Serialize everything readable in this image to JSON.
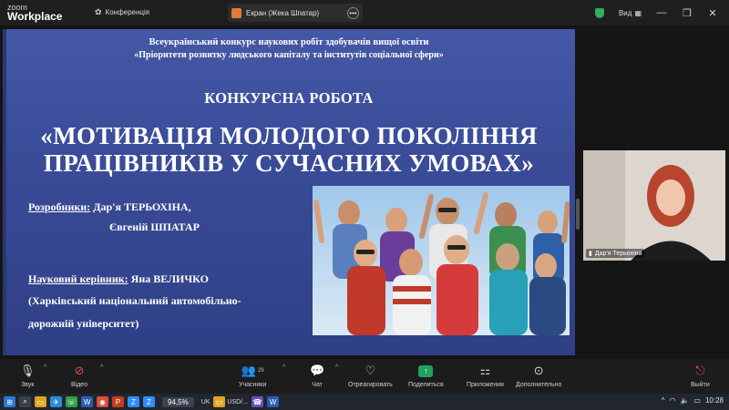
{
  "app": {
    "logo_line1": "zoom",
    "logo_line2": "Workplace",
    "conference_label": "Конференція",
    "screen_share_label": "Екран (Жека Шпатар)",
    "view_label": "Вид"
  },
  "slide": {
    "header_line1": "Всеукраїнський конкурс наукових робіт здобувачів вищої освіти",
    "header_line2": "«Пріоритети розвитку людського капіталу та інститутів соціальної сфери»",
    "section_title": "КОНКУРСНА РОБОТА",
    "work_title_line1": "«МОТИВАЦІЯ МОЛОДОГО ПОКОЛІННЯ",
    "work_title_line2": "ПРАЦІВНИКІВ У СУЧАСНИХ УМОВАХ»",
    "developers_label": "Розробники:",
    "developer1": "Дар'я ТЕРЬОХІНА,",
    "developer2": "Євгеній ШПАТАР",
    "supervisor_label": "Науковий керівник:",
    "supervisor_name": "Яна ВЕЛИЧКО",
    "university_line1": "(Харківський національний автомобільно-",
    "university_line2": "дорожній університет)"
  },
  "self_view": {
    "name": "Дар'я Терьохіна"
  },
  "toolbar": {
    "audio_label": "Звук",
    "video_label": "Відео",
    "participants_label": "Учасники",
    "participants_count": "29",
    "chat_label": "Чат",
    "react_label": "Отреагировать",
    "share_label": "Поделиться",
    "apps_label": "Приложения",
    "more_label": "Дополнительно",
    "leave_label": "Выйти"
  },
  "taskbar": {
    "zoom_level": "94,5%",
    "lang": "UK",
    "currency": "USD/...",
    "time": "10:28"
  },
  "colors": {
    "slide_blue": "#3a4c98",
    "share_green": "#1fa35e",
    "leave_red": "#e24a4a"
  }
}
